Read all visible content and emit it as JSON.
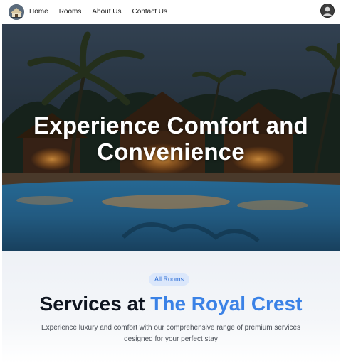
{
  "nav": {
    "logo_icon": "hotel-logo-icon",
    "links": [
      "Home",
      "Rooms",
      "About Us",
      "Contact Us"
    ],
    "profile_icon": "user-avatar-icon"
  },
  "hero": {
    "title_line1": "Experience Comfort and",
    "title_line2": "Convenience",
    "background": "resort-pool-night-image"
  },
  "services": {
    "badge": "All Rooms",
    "title_prefix": "Services at ",
    "title_accent": "The Royal Crest",
    "description_line1": "Experience luxury and comfort with our comprehensive range of premium services",
    "description_line2": "designed for your perfect stay"
  },
  "colors": {
    "accent": "#3b82e6",
    "badge_bg": "#dbe7fb",
    "badge_text": "#2f6fd6",
    "title_text": "#0f1520"
  }
}
